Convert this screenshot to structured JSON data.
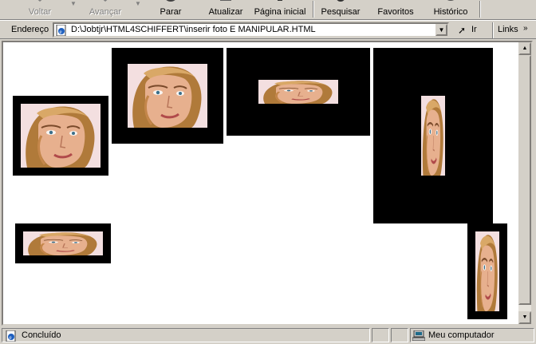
{
  "toolbar": {
    "back_label": "Voltar",
    "forward_label": "Avançar",
    "stop_label": "Parar",
    "refresh_label": "Atualizar",
    "home_label": "Página inicial",
    "search_label": "Pesquisar",
    "favorites_label": "Favoritos",
    "history_label": "Histórico"
  },
  "address_bar": {
    "label": "Endereço",
    "url": "D:\\Jobtjr\\HTML4SCHIFFERT\\inserir foto E MANIPULAR.HTML",
    "go_label": "Ir",
    "links_label": "Links"
  },
  "content": {
    "photos_count": 6
  },
  "status_bar": {
    "text": "Concluído",
    "zone": "Meu computador"
  },
  "colors": {
    "chrome": "#d4d0c8",
    "content_bg": "#ffffff",
    "frame": "#000000"
  }
}
